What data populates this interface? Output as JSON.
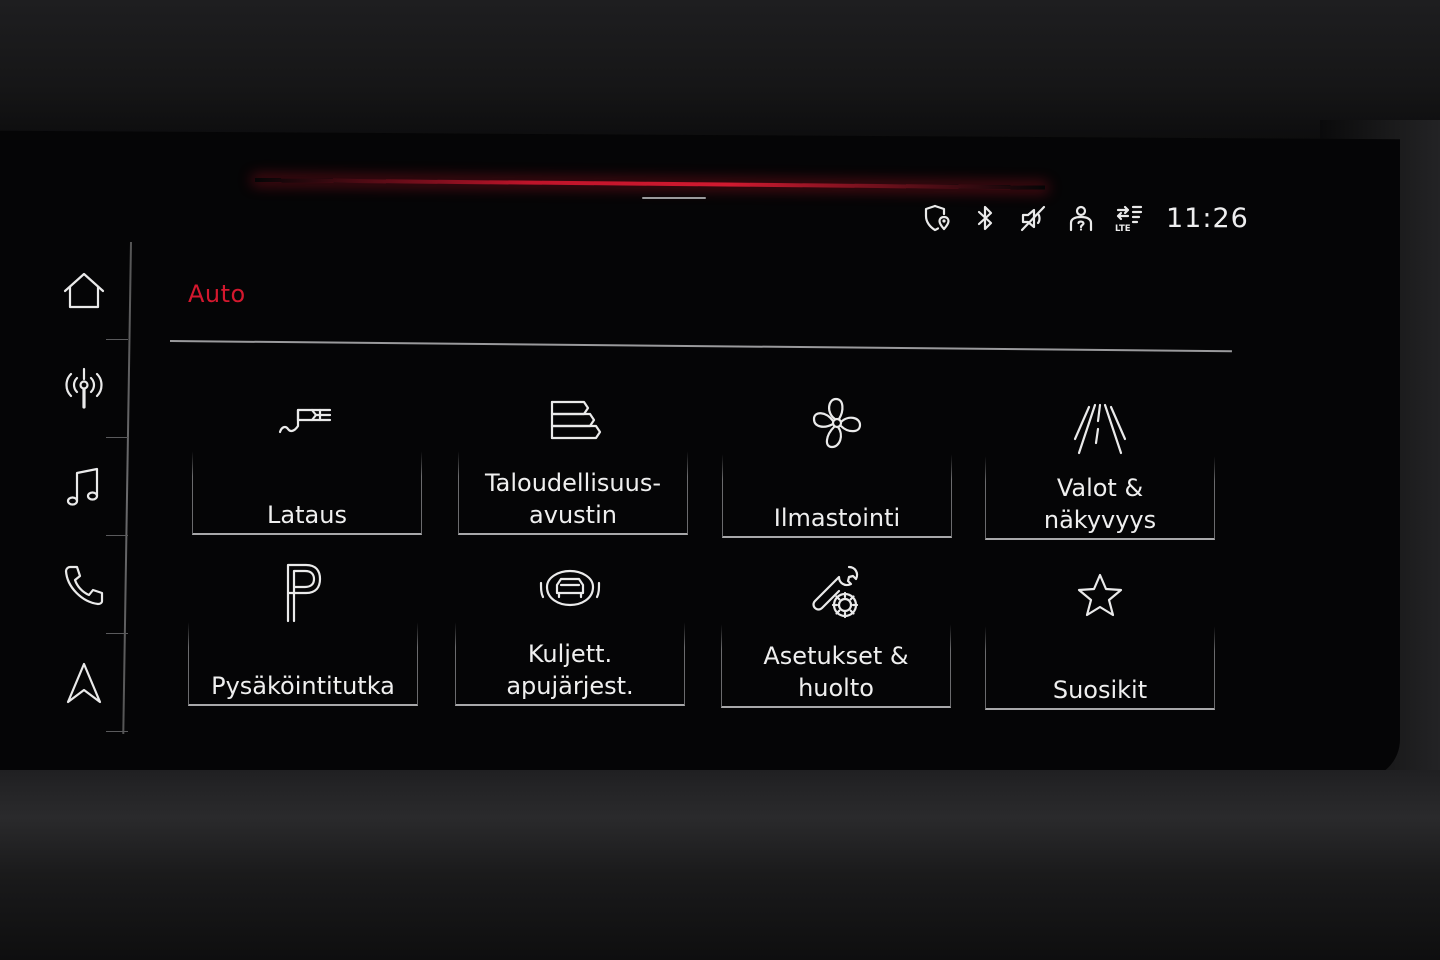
{
  "status_bar": {
    "icons": [
      "geo-shield-icon",
      "bluetooth-icon",
      "muted-speaker-icon",
      "driver-profile-icon",
      "lte-data-icon"
    ],
    "lte_label": "LTE",
    "time": "11:26"
  },
  "side_rail": {
    "items": [
      {
        "icon": "home-icon"
      },
      {
        "icon": "radio-antenna-icon"
      },
      {
        "icon": "music-note-icon"
      },
      {
        "icon": "phone-icon"
      },
      {
        "icon": "navigation-arrow-icon"
      }
    ]
  },
  "header": {
    "title": "Auto"
  },
  "tiles": [
    {
      "label": "Lataus",
      "icon": "charging-plug-icon"
    },
    {
      "label": "Taloudellisuus-\navustin",
      "icon": "efficiency-bars-icon"
    },
    {
      "label": "Ilmastointi",
      "icon": "fan-icon"
    },
    {
      "label": "Valot &\nnäkyvyys",
      "icon": "road-lines-icon"
    },
    {
      "label": "Pysäköintitutka",
      "icon": "parking-p-icon"
    },
    {
      "label": "Kuljett.\napujärjest.",
      "icon": "driver-assist-car-icon"
    },
    {
      "label": "Asetukset &\nhuolto",
      "icon": "wrench-gear-icon"
    },
    {
      "label": "Suosikit",
      "icon": "star-icon"
    }
  ],
  "colors": {
    "accent": "#d4182e",
    "background": "#050506",
    "text": "#efefef"
  }
}
